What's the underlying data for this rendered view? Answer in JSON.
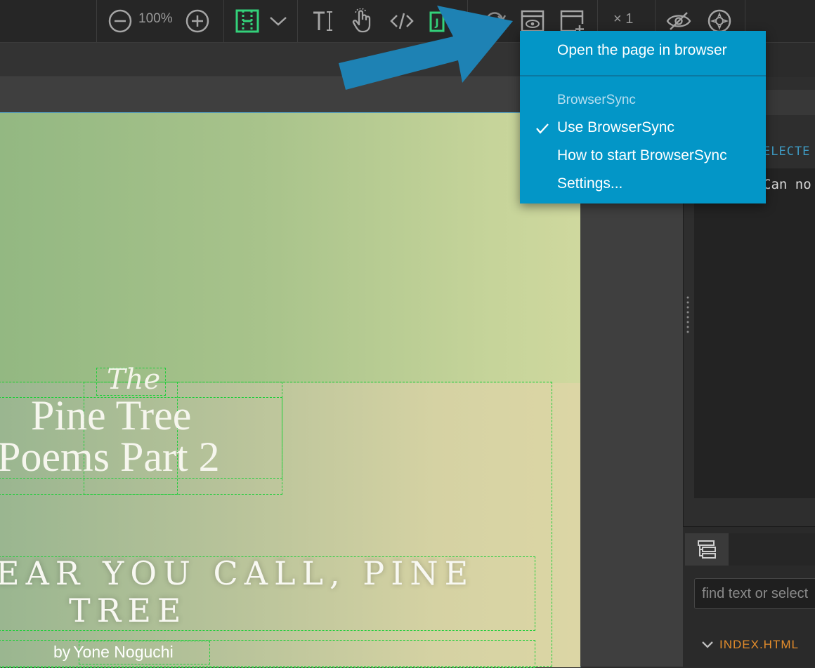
{
  "toolbar": {
    "zoom_value": "100%",
    "multiplier": "× 1"
  },
  "page": {
    "title_the": "The",
    "title_line1": "Pine Tree",
    "title_line2": "Poems Part 2",
    "heading_line1": "EAR YOU CALL, PINE",
    "heading_line2": "TREE",
    "byline_prefix": "by",
    "byline_author": "Yone Noguchi"
  },
  "menu": {
    "open_in_browser": "Open the page in browser",
    "section_header": "BrowserSync",
    "use_browsersync": "Use BrowserSync",
    "use_browsersync_checked": true,
    "how_to_start": "How to start BrowserSync",
    "settings": "Settings..."
  },
  "right_panel": {
    "selected_label": "ELECTE",
    "code_text": "Can no",
    "find_placeholder": "find text or select",
    "tree_root": "INDEX.HTML"
  },
  "colors": {
    "accent_green": "#33d17a",
    "menu_blue": "#0396c7",
    "arrow_blue": "#1e82b4",
    "tree_orange": "#e38c2b"
  }
}
